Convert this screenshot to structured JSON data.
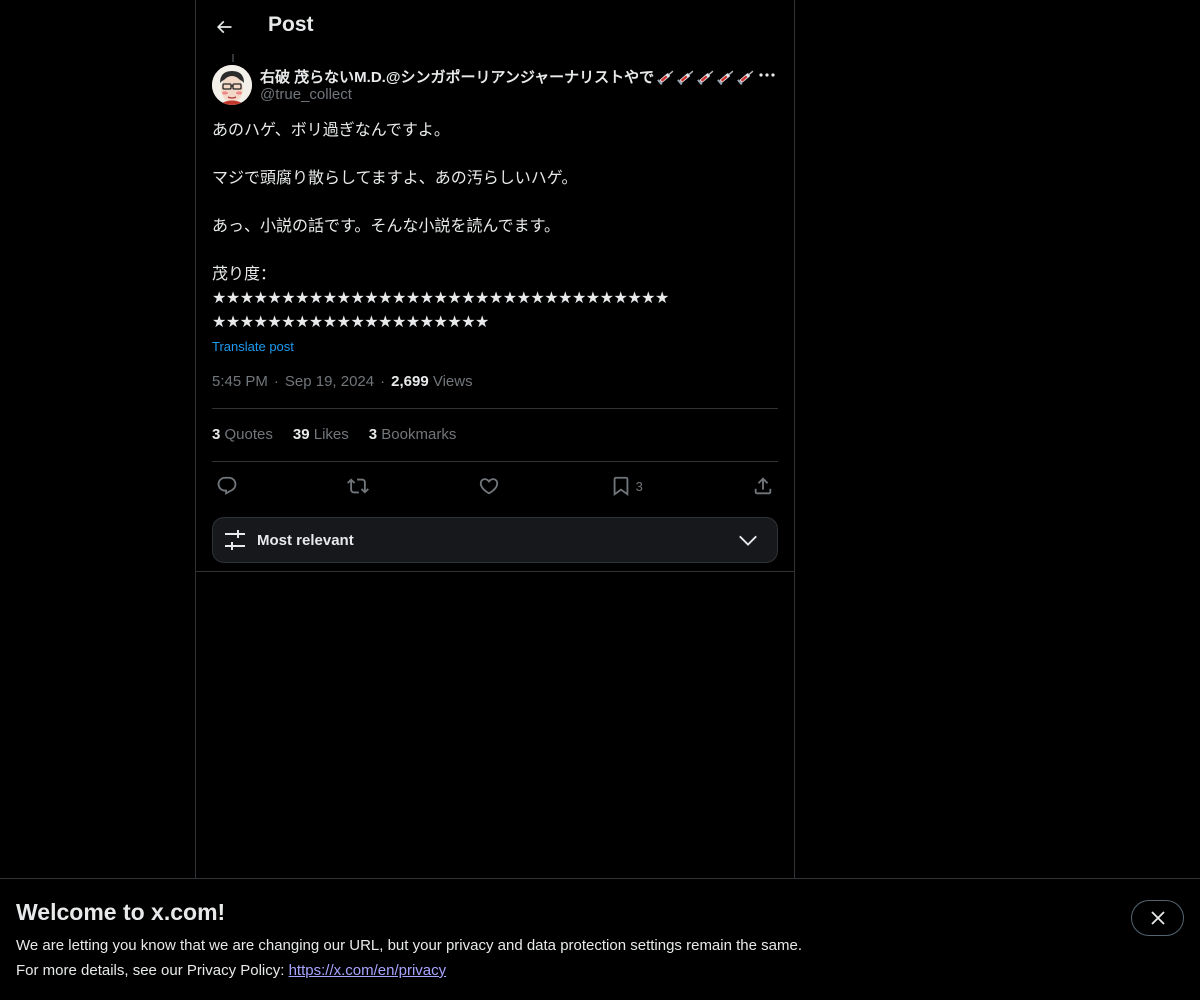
{
  "header": {
    "title": "Post"
  },
  "author": {
    "name": "右破 茂らないM.D.@シンガポーリアンジャーナリストやで",
    "syringe_count": 5,
    "handle": "@true_collect"
  },
  "post": {
    "line1": "あのハゲ、ボリ過ぎなんですよ。",
    "line2": "マジで頭腐り散らしてますよ、あの汚らしいハゲ。",
    "line3": "あっ、小説の話です。そんな小説を読んでます。",
    "line4": "茂り度：",
    "stars_row1": "★★★★★★★★★★★★★★★★★★★★★★★★★★★★★★★★★",
    "stars_row2": "★★★★★★★★★★★★★★★★★★★★",
    "translate": "Translate post"
  },
  "meta": {
    "time": "5:45 PM",
    "sep": "·",
    "date": "Sep 19, 2024",
    "views_count": "2,699",
    "views_label": "Views"
  },
  "stats": {
    "quotes_count": "3",
    "quotes_label": "Quotes",
    "likes_count": "39",
    "likes_label": "Likes",
    "bookmarks_count": "3",
    "bookmarks_label": "Bookmarks"
  },
  "actions": {
    "reply_icon": "reply-icon",
    "repost_icon": "repost-icon",
    "like_icon": "heart-icon",
    "bookmark_icon": "bookmark-icon",
    "bookmark_count": "3",
    "share_icon": "share-icon"
  },
  "sort": {
    "label": "Most relevant"
  },
  "banner": {
    "title": "Welcome to x.com!",
    "line1": "We are letting you know that we are changing our URL, but your privacy and data protection settings remain the same.",
    "line2_prefix": "For more details, see our Privacy Policy: ",
    "link": "https://x.com/en/privacy"
  },
  "colors": {
    "background": "#000000",
    "text": "#e7e9ea",
    "muted": "#71767b",
    "accent": "#1d9bf0",
    "border": "#2f3336",
    "link": "#a8a4ff"
  }
}
